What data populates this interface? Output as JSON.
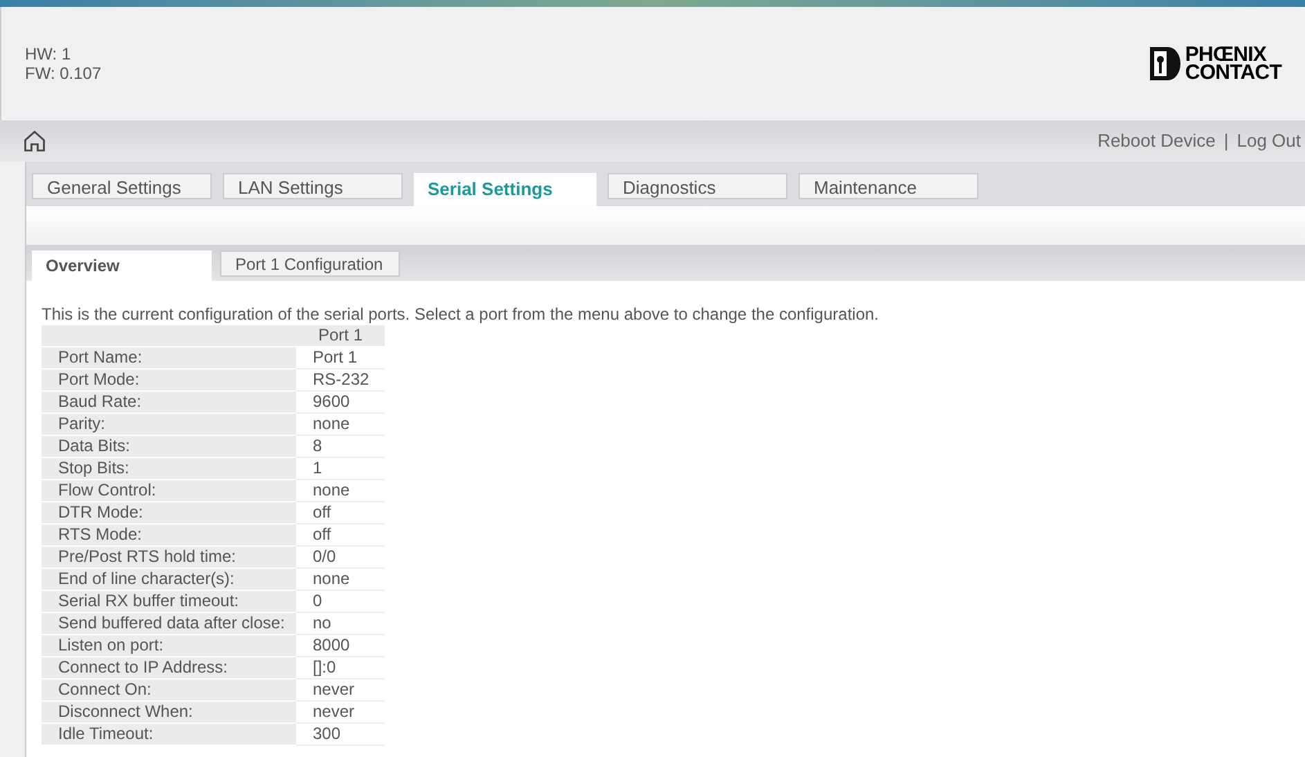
{
  "header": {
    "hw": "HW: 1",
    "fw": "FW: 0.107",
    "logo": [
      "PHŒNIX",
      "CONTACT"
    ]
  },
  "nav": {
    "links": [
      "Reboot Device",
      "Log Out"
    ],
    "separator": "|"
  },
  "tabs": [
    {
      "label": "General Settings",
      "selected": false
    },
    {
      "label": "LAN Settings",
      "selected": false
    },
    {
      "label": "Serial Settings",
      "selected": true
    },
    {
      "label": "Diagnostics",
      "selected": false
    },
    {
      "label": "Maintenance",
      "selected": false
    }
  ],
  "subtabs": [
    {
      "label": "Overview",
      "selected": true
    },
    {
      "label": "Port 1 Configuration",
      "selected": false
    }
  ],
  "intro": "This is the current configuration of the serial ports. Select a port from the menu above to change the configuration.",
  "table": {
    "columns": [
      "",
      "Port 1"
    ],
    "rows": [
      [
        "Port Name:",
        "Port 1"
      ],
      [
        "Port Mode:",
        "RS-232"
      ],
      [
        "Baud Rate:",
        "9600"
      ],
      [
        "Parity:",
        "none"
      ],
      [
        "Data Bits:",
        "8"
      ],
      [
        "Stop Bits:",
        "1"
      ],
      [
        "Flow Control:",
        "none"
      ],
      [
        "DTR Mode:",
        "off"
      ],
      [
        "RTS Mode:",
        "off"
      ],
      [
        "Pre/Post RTS hold time:",
        "0/0"
      ],
      [
        "End of line character(s):",
        "none"
      ],
      [
        "Serial RX buffer timeout:",
        "0"
      ],
      [
        "Send buffered data after close:",
        "no"
      ],
      [
        "Listen on port:",
        "8000"
      ],
      [
        "Connect to IP Address:",
        "[]:0"
      ],
      [
        "Connect On:",
        "never"
      ],
      [
        "Disconnect When:",
        "never"
      ],
      [
        "Idle Timeout:",
        "300"
      ]
    ]
  }
}
